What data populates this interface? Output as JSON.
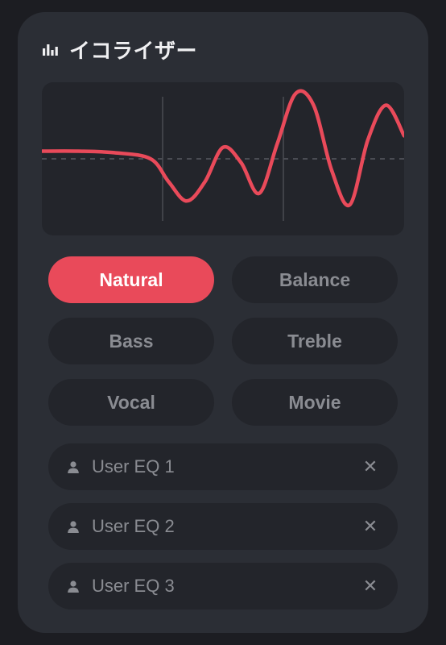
{
  "header": {
    "title": "イコライザー"
  },
  "presets": [
    {
      "id": "natural",
      "label": "Natural",
      "active": true
    },
    {
      "id": "balance",
      "label": "Balance",
      "active": false
    },
    {
      "id": "bass",
      "label": "Bass",
      "active": false
    },
    {
      "id": "treble",
      "label": "Treble",
      "active": false
    },
    {
      "id": "vocal",
      "label": "Vocal",
      "active": false
    },
    {
      "id": "movie",
      "label": "Movie",
      "active": false
    }
  ],
  "user_eqs": [
    {
      "label": "User EQ 1"
    },
    {
      "label": "User EQ 2"
    },
    {
      "label": "User EQ 3"
    }
  ],
  "colors": {
    "accent": "#e94a5a",
    "panel_bg": "#2b2e35",
    "inner_bg": "#23252b",
    "muted_text": "#8a8c92"
  },
  "chart_data": {
    "type": "line",
    "title": "",
    "xlabel": "",
    "ylabel": "",
    "x": [
      0,
      0.1,
      0.2,
      0.3,
      0.35,
      0.4,
      0.45,
      0.5,
      0.55,
      0.6,
      0.65,
      0.7,
      0.75,
      0.8,
      0.85,
      0.9,
      0.95,
      1.0
    ],
    "values": [
      0.1,
      0.1,
      0.08,
      0.0,
      -0.3,
      -0.55,
      -0.3,
      0.15,
      -0.05,
      -0.45,
      0.2,
      0.85,
      0.7,
      -0.15,
      -0.6,
      0.25,
      0.7,
      0.3
    ],
    "ylim": [
      -1,
      1
    ],
    "xlim": [
      0,
      1
    ],
    "gridlines": {
      "horizontal_center": true,
      "vertical_markers": [
        0.33,
        0.66
      ]
    }
  }
}
